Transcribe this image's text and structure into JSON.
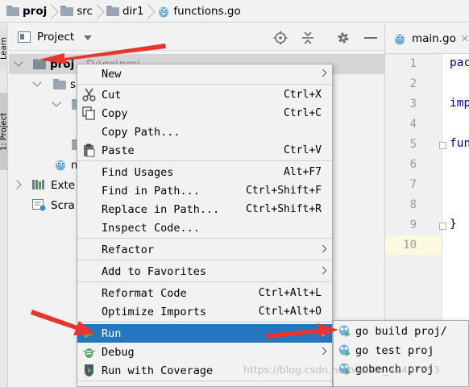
{
  "breadcrumb": [
    {
      "label": "proj",
      "bold": true,
      "icon": "folder-icon"
    },
    {
      "label": "src",
      "bold": false,
      "icon": "folder-icon"
    },
    {
      "label": "dir1",
      "bold": false,
      "icon": "folder-icon"
    },
    {
      "label": "functions.go",
      "bold": false,
      "icon": "go-file-icon"
    }
  ],
  "left_strip": {
    "tabs": [
      "Learn",
      "1: Project"
    ]
  },
  "project_panel": {
    "title": "Project",
    "actions": [
      "locate-icon",
      "collapse-all-icon",
      "settings-icon",
      "hide-icon"
    ],
    "tree": [
      {
        "label": "proj",
        "path": "D:\\go\\proj",
        "icon": "folder-icon",
        "arrow": "down",
        "selected": true
      },
      {
        "label": "src",
        "icon": "folder-icon",
        "arrow": "down"
      },
      {
        "label": "",
        "icon": "folder-icon",
        "arrow": "down"
      },
      {
        "label": "",
        "icon": "go-file-icon"
      },
      {
        "label": "m",
        "icon": "go-file-icon"
      },
      {
        "label": "Exte",
        "icon": "external-libraries-icon",
        "arrow": "right"
      },
      {
        "label": "Scra",
        "icon": "scratches-icon"
      }
    ]
  },
  "editor": {
    "tab_label": "main.go",
    "line_numbers": [
      "1",
      "2",
      "3",
      "4",
      "5",
      "6",
      "7",
      "8",
      "9",
      "10"
    ],
    "code": {
      "line1": "pac",
      "line3": "imp",
      "line5": "fun",
      "line9": "}"
    }
  },
  "context_menu": {
    "items": [
      {
        "label": "New",
        "shortcut": "",
        "submenu": true
      },
      {
        "label": "Cut",
        "shortcut": "Ctrl+X",
        "icon": "scissors-icon"
      },
      {
        "label": "Copy",
        "shortcut": "Ctrl+C",
        "icon": "copy-icon"
      },
      {
        "label": "Copy Path...",
        "shortcut": ""
      },
      {
        "label": "Paste",
        "shortcut": "Ctrl+V",
        "icon": "paste-icon"
      },
      {
        "label": "Find Usages",
        "shortcut": "Alt+F7"
      },
      {
        "label": "Find in Path...",
        "shortcut": "Ctrl+Shift+F"
      },
      {
        "label": "Replace in Path...",
        "shortcut": "Ctrl+Shift+R"
      },
      {
        "label": "Inspect Code...",
        "shortcut": ""
      },
      {
        "label": "Refactor",
        "shortcut": "",
        "submenu": true
      },
      {
        "label": "Add to Favorites",
        "shortcut": "",
        "submenu": true
      },
      {
        "label": "Reformat Code",
        "shortcut": "Ctrl+Alt+L"
      },
      {
        "label": "Optimize Imports",
        "shortcut": "Ctrl+Alt+O"
      },
      {
        "label": "Run",
        "shortcut": "",
        "submenu": true,
        "highlight": true,
        "icon": "run-icon"
      },
      {
        "label": "Debug",
        "shortcut": "",
        "submenu": true,
        "icon": "debug-icon"
      },
      {
        "label": "Run with Coverage",
        "shortcut": "",
        "icon": "coverage-icon"
      }
    ]
  },
  "run_submenu": {
    "items": [
      {
        "label": "go build proj/",
        "icon": "go-run-config-icon"
      },
      {
        "label": "go test proj",
        "icon": "go-test-config-icon"
      },
      {
        "label": "gobench proj",
        "icon": "go-bench-config-icon"
      }
    ]
  },
  "colors": {
    "menu_highlight": "#2675bf",
    "annotation_arrow": "#e8352d",
    "selection_row": "#d5d5d5",
    "caret_line": "#fcf9e0"
  },
  "watermark": "https://blog.csdn.net/weixin_42407653"
}
